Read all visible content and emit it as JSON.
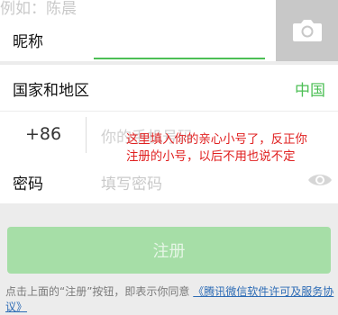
{
  "nickname": {
    "label": "昵称",
    "placeholder": "例如：陈晨"
  },
  "photo": {
    "icon": "camera-icon"
  },
  "region": {
    "label": "国家和地区",
    "value": "中国"
  },
  "phone": {
    "code": "+86",
    "placeholder": "你的手机号码"
  },
  "password": {
    "label": "密码",
    "placeholder": "填写密码",
    "toggle_icon": "eye-icon"
  },
  "register": {
    "label": "注册"
  },
  "agreement": {
    "text": "点击上面的“注册”按钮，即表示你同意",
    "link": "《腾讯微信软件许可及服务协议》"
  },
  "annotation": {
    "line1": "这里填入你的亲心小号了，反正你",
    "line2": "注册的小号，以后不用也说不定"
  },
  "colors": {
    "accent": "#4cbf55",
    "button_disabled": "#a6dea7",
    "link": "#2c6bb5",
    "annotation": "#e02020"
  }
}
